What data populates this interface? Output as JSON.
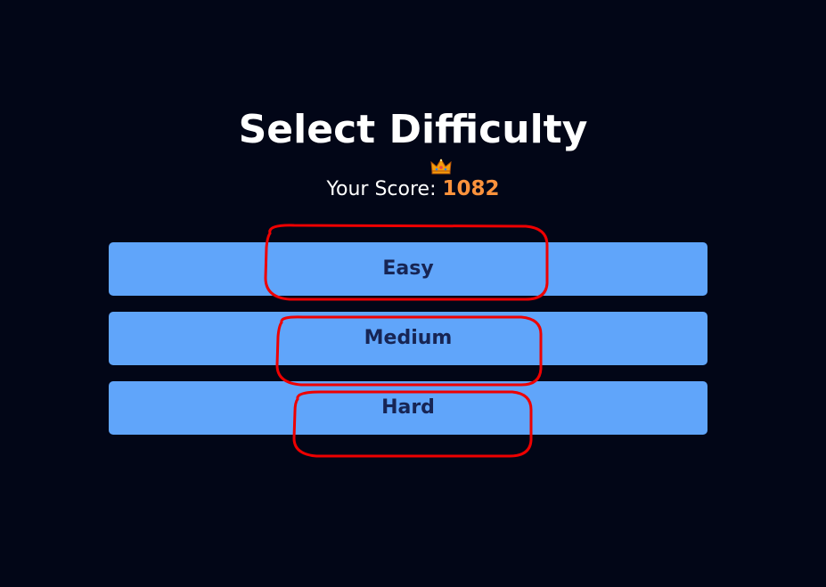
{
  "header": {
    "title": "Select Difficulty"
  },
  "score": {
    "label": "Your Score: ",
    "value": "1082",
    "icon": "crown-icon",
    "value_color": "#fb923c"
  },
  "difficulties": [
    {
      "label": "Easy"
    },
    {
      "label": "Medium"
    },
    {
      "label": "Hard"
    }
  ],
  "colors": {
    "background": "#020617",
    "button_bg": "#60a5fa",
    "button_text": "#172554",
    "annotation": "#ee0000"
  }
}
